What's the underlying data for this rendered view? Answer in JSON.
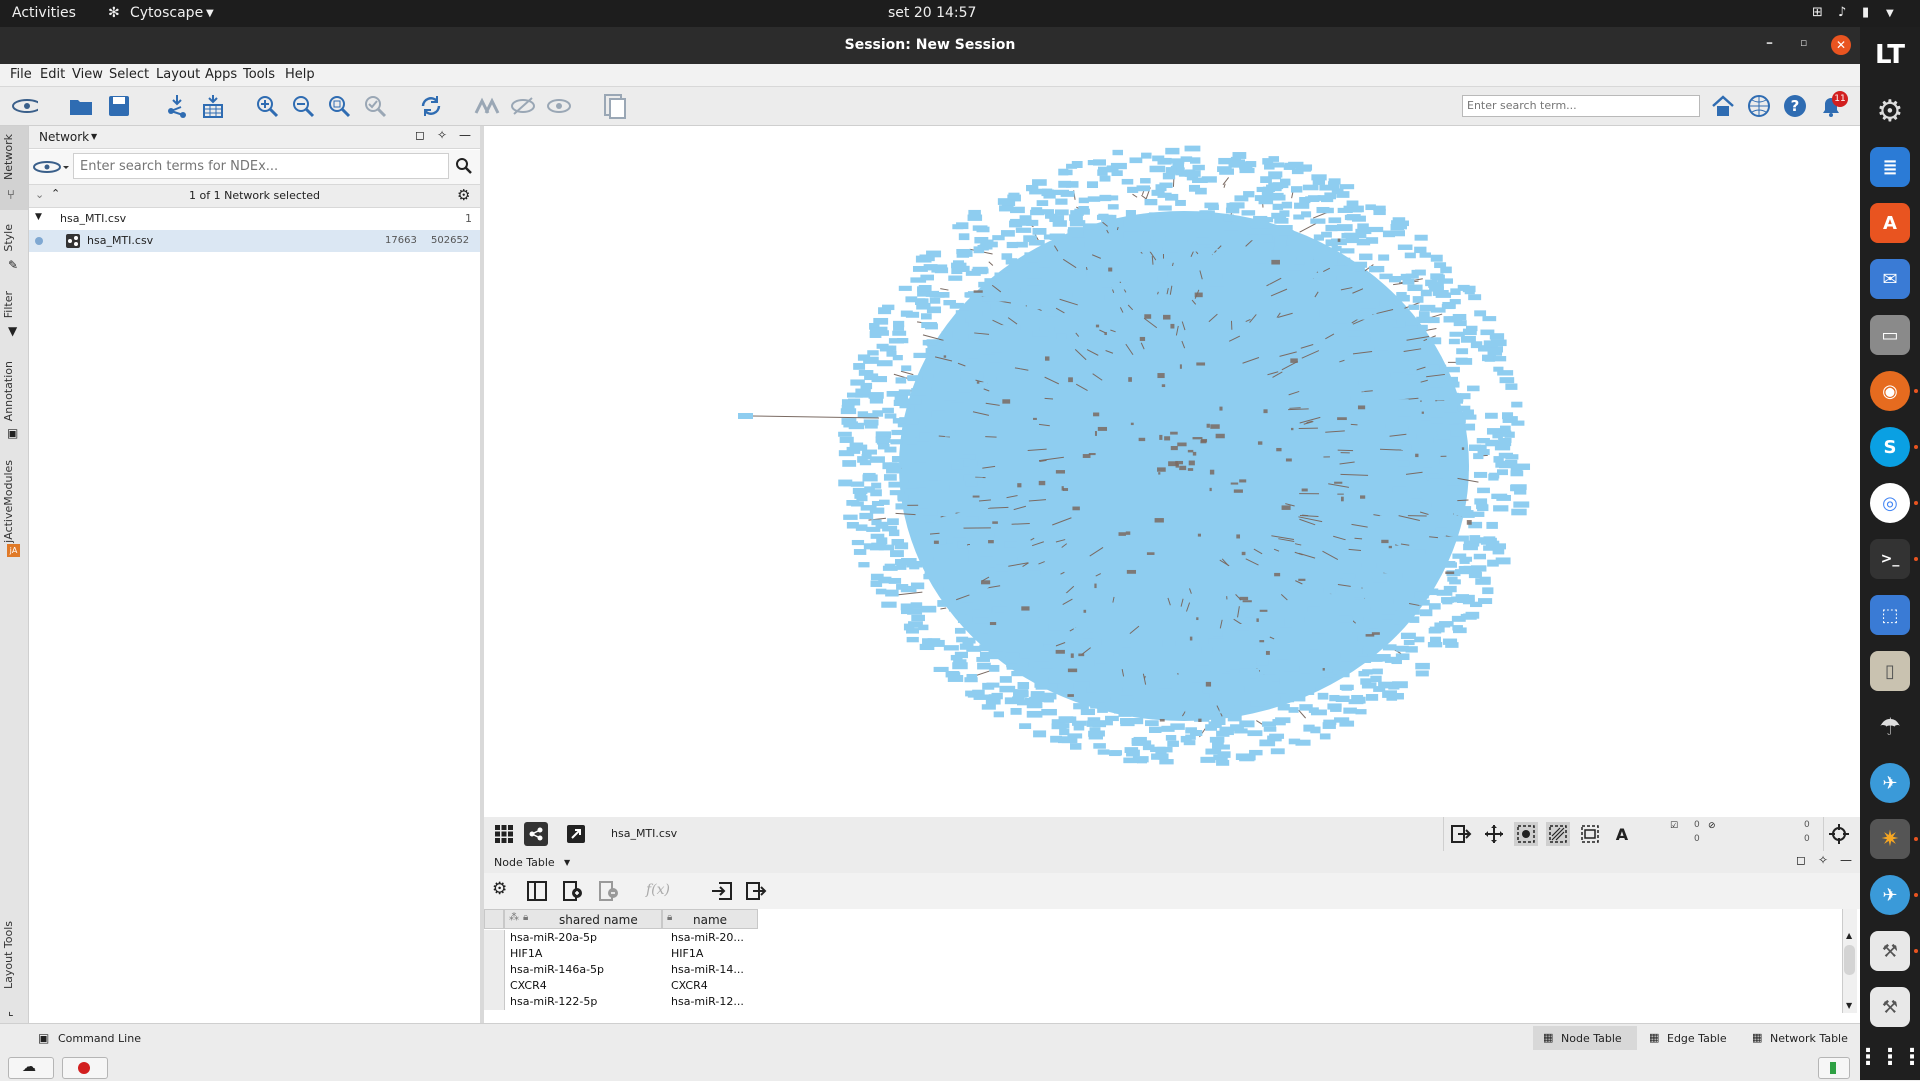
{
  "topbar": {
    "activities": "Activities",
    "app_menu": "Cytoscape",
    "clock": "set 20  14:57"
  },
  "window": {
    "title": "Session: New Session"
  },
  "menu": {
    "items": [
      "File",
      "Edit",
      "View",
      "Select",
      "Layout",
      "Apps",
      "Tools",
      "Help"
    ]
  },
  "toolbar": {
    "search_placeholder": "Enter search term...",
    "notification_count": "11"
  },
  "side_tabs": [
    "Network",
    "Style",
    "Filter",
    "Annotation",
    "jActiveModules",
    "Layout Tools"
  ],
  "network_panel": {
    "header": "Network",
    "ndex_placeholder": "Enter search terms for NDEx...",
    "selected_text": "1 of 1 Network selected",
    "collection": {
      "name": "hsa_MTI.csv",
      "count": "1"
    },
    "network": {
      "name": "hsa_MTI.csv",
      "nodes": "17663",
      "edges": "502652"
    }
  },
  "canvas_bar": {
    "network_name": "hsa_MTI.csv",
    "counts": {
      "nodes_selected": "0",
      "nodes_hidden": "0",
      "edges_selected": "0",
      "edges_hidden": "0"
    }
  },
  "table_panel": {
    "header": "Node Table",
    "fx_label": "f(x)",
    "columns": [
      "shared name",
      "name"
    ],
    "rows": [
      [
        "hsa-miR-20a-5p",
        "hsa-miR-20..."
      ],
      [
        "HIF1A",
        "HIF1A"
      ],
      [
        "hsa-miR-146a-5p",
        "hsa-miR-14..."
      ],
      [
        "CXCR4",
        "CXCR4"
      ],
      [
        "hsa-miR-122-5p",
        "hsa-miR-12..."
      ]
    ]
  },
  "status_bar": {
    "command_line": "Command Line",
    "tabs": [
      "Node Table",
      "Edge Table",
      "Network Table"
    ]
  },
  "colors": {
    "node_color": "#8ecdf0",
    "edge_color": "#7a6a62",
    "accent": "#1e6fb8"
  }
}
